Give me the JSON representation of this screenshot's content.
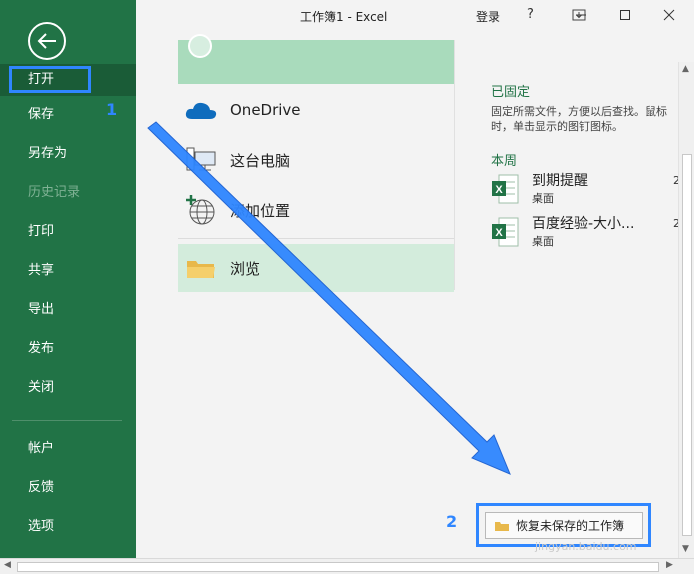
{
  "window": {
    "title": "工作簿1  -  Excel",
    "login": "登录",
    "help": "?"
  },
  "sidebar": {
    "items": [
      {
        "label": "打开"
      },
      {
        "label": "保存"
      },
      {
        "label": "另存为"
      },
      {
        "label": "历史记录"
      },
      {
        "label": "打印"
      },
      {
        "label": "共享"
      },
      {
        "label": "导出"
      },
      {
        "label": "发布"
      },
      {
        "label": "关闭"
      },
      {
        "label": "帐户"
      },
      {
        "label": "反馈"
      },
      {
        "label": "选项"
      }
    ]
  },
  "locations": [
    {
      "label": "OneDrive",
      "icon": "cloud-icon"
    },
    {
      "label": "这台电脑",
      "icon": "computer-icon"
    },
    {
      "label": "添加位置",
      "icon": "globe-add-icon"
    },
    {
      "label": "浏览",
      "icon": "folder-icon"
    }
  ],
  "recent": {
    "pinned_heading": "已固定",
    "pinned_hint_1": "固定所需文件，方便以后查找。鼠标",
    "pinned_hint_2": "时，单击显示的图钉图标。",
    "week_heading": "本周",
    "files": [
      {
        "name": "到期提醒",
        "location": "桌面",
        "date": "2"
      },
      {
        "name": "百度经验-大小...",
        "location": "桌面",
        "date": "2"
      }
    ]
  },
  "recover_button": "恢复未保存的工作簿",
  "annotations": {
    "step1": "1",
    "step2": "2"
  },
  "watermark": "jingyan.baidu.com",
  "colors": {
    "excel_green": "#217346",
    "annotation_blue": "#2f86ff"
  }
}
